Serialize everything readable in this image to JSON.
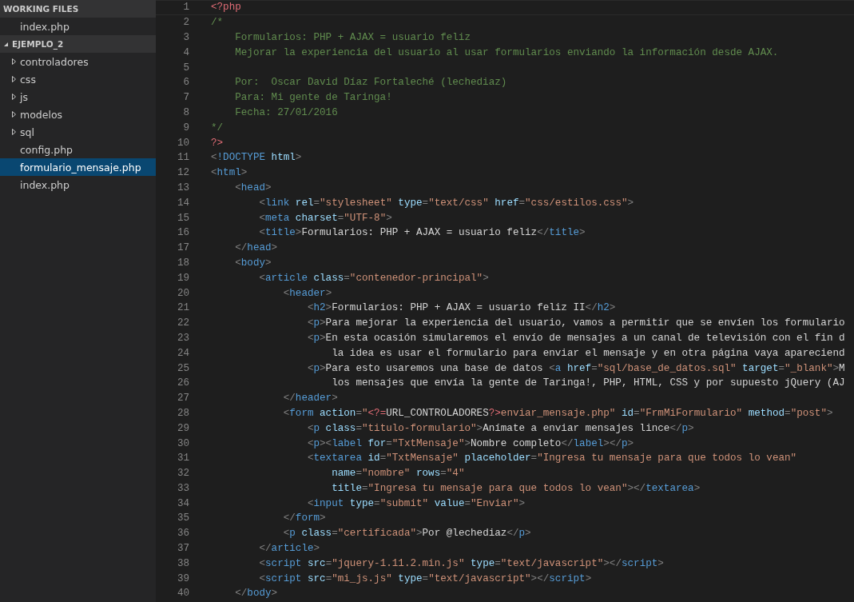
{
  "sidebar": {
    "sections": [
      {
        "title": "WORKING FILES",
        "items": [
          {
            "label": "index.php",
            "kind": "file",
            "selected": false
          }
        ]
      },
      {
        "title": "EJEMPLO_2",
        "expanded": true,
        "items": [
          {
            "label": "controladores",
            "kind": "folder",
            "expanded": false,
            "selected": false
          },
          {
            "label": "css",
            "kind": "folder",
            "expanded": false,
            "selected": false
          },
          {
            "label": "js",
            "kind": "folder",
            "expanded": false,
            "selected": false
          },
          {
            "label": "modelos",
            "kind": "folder",
            "expanded": false,
            "selected": false
          },
          {
            "label": "sql",
            "kind": "folder",
            "expanded": false,
            "selected": false
          },
          {
            "label": "config.php",
            "kind": "file",
            "selected": false
          },
          {
            "label": "formulario_mensaje.php",
            "kind": "file",
            "selected": true
          },
          {
            "label": "index.php",
            "kind": "file",
            "selected": false
          }
        ]
      }
    ]
  },
  "editor": {
    "lines": [
      {
        "number": "1",
        "current": true,
        "tokens": [
          {
            "kind": "php",
            "text": "<?php"
          }
        ]
      },
      {
        "number": "2",
        "current": false,
        "tokens": [
          {
            "kind": "comment",
            "text": "/*"
          }
        ]
      },
      {
        "number": "3",
        "current": false,
        "tokens": [
          {
            "kind": "comment",
            "text": "    Formularios: PHP + AJAX = usuario feliz"
          }
        ]
      },
      {
        "number": "4",
        "current": false,
        "tokens": [
          {
            "kind": "comment",
            "text": "    Mejorar la experiencia del usuario al usar formularios enviando la información desde AJAX."
          }
        ]
      },
      {
        "number": "5",
        "current": false
      },
      {
        "number": "6",
        "current": false,
        "tokens": [
          {
            "kind": "comment",
            "text": "    Por:  Oscar David Díaz Fortaleché (lechediaz)"
          }
        ]
      },
      {
        "number": "7",
        "current": false,
        "tokens": [
          {
            "kind": "comment",
            "text": "    Para: Mi gente de Taringa!"
          }
        ]
      },
      {
        "number": "8",
        "current": false,
        "tokens": [
          {
            "kind": "comment",
            "text": "    Fecha: 27/01/2016"
          }
        ]
      },
      {
        "number": "9",
        "current": false,
        "tokens": [
          {
            "kind": "comment",
            "text": "*/"
          }
        ]
      },
      {
        "number": "10",
        "current": false,
        "tokens": [
          {
            "kind": "php",
            "text": "?>"
          }
        ]
      },
      {
        "number": "11",
        "current": false,
        "tokens": [
          {
            "kind": "punct",
            "text": "<"
          },
          {
            "kind": "tag",
            "text": "!DOCTYPE"
          },
          {
            "kind": "attr",
            "text": " html"
          },
          {
            "kind": "punct",
            "text": ">"
          }
        ]
      },
      {
        "number": "12",
        "current": false,
        "tokens": [
          {
            "kind": "punct",
            "text": "<"
          },
          {
            "kind": "tag",
            "text": "html"
          },
          {
            "kind": "punct",
            "text": ">"
          }
        ]
      },
      {
        "number": "13",
        "current": false,
        "tokens": [
          {
            "kind": "punct",
            "text": "    <"
          },
          {
            "kind": "tag",
            "text": "head"
          },
          {
            "kind": "punct",
            "text": ">"
          }
        ]
      },
      {
        "number": "14",
        "current": false,
        "tokens": [
          {
            "kind": "punct",
            "text": "        <"
          },
          {
            "kind": "tag",
            "text": "link"
          },
          {
            "kind": "attr",
            "text": " rel"
          },
          {
            "kind": "punct",
            "text": "="
          },
          {
            "kind": "string",
            "text": "\"stylesheet\""
          },
          {
            "kind": "attr",
            "text": " type"
          },
          {
            "kind": "punct",
            "text": "="
          },
          {
            "kind": "string",
            "text": "\"text/css\""
          },
          {
            "kind": "attr",
            "text": " href"
          },
          {
            "kind": "punct",
            "text": "="
          },
          {
            "kind": "string",
            "text": "\"css/estilos.css\""
          },
          {
            "kind": "punct",
            "text": ">"
          }
        ]
      },
      {
        "number": "15",
        "current": false,
        "tokens": [
          {
            "kind": "punct",
            "text": "        <"
          },
          {
            "kind": "tag",
            "text": "meta"
          },
          {
            "kind": "attr",
            "text": " charset"
          },
          {
            "kind": "punct",
            "text": "="
          },
          {
            "kind": "string",
            "text": "\"UTF-8\""
          },
          {
            "kind": "punct",
            "text": ">"
          }
        ]
      },
      {
        "number": "16",
        "current": false,
        "tokens": [
          {
            "kind": "punct",
            "text": "        <"
          },
          {
            "kind": "tag",
            "text": "title"
          },
          {
            "kind": "punct",
            "text": ">"
          },
          {
            "kind": "text",
            "text": "Formularios: PHP + AJAX = usuario feliz"
          },
          {
            "kind": "punct",
            "text": "</"
          },
          {
            "kind": "tag",
            "text": "title"
          },
          {
            "kind": "punct",
            "text": ">"
          }
        ]
      },
      {
        "number": "17",
        "current": false,
        "tokens": [
          {
            "kind": "punct",
            "text": "    </"
          },
          {
            "kind": "tag",
            "text": "head"
          },
          {
            "kind": "punct",
            "text": ">"
          }
        ]
      },
      {
        "number": "18",
        "current": false,
        "tokens": [
          {
            "kind": "punct",
            "text": "    <"
          },
          {
            "kind": "tag",
            "text": "body"
          },
          {
            "kind": "punct",
            "text": ">"
          }
        ]
      },
      {
        "number": "19",
        "current": false,
        "tokens": [
          {
            "kind": "punct",
            "text": "        <"
          },
          {
            "kind": "tag",
            "text": "article"
          },
          {
            "kind": "attr",
            "text": " class"
          },
          {
            "kind": "punct",
            "text": "="
          },
          {
            "kind": "string",
            "text": "\"contenedor-principal\""
          },
          {
            "kind": "punct",
            "text": ">"
          }
        ]
      },
      {
        "number": "20",
        "current": false,
        "tokens": [
          {
            "kind": "punct",
            "text": "            <"
          },
          {
            "kind": "tag",
            "text": "header"
          },
          {
            "kind": "punct",
            "text": ">"
          }
        ]
      },
      {
        "number": "21",
        "current": false,
        "tokens": [
          {
            "kind": "punct",
            "text": "                <"
          },
          {
            "kind": "tag",
            "text": "h2"
          },
          {
            "kind": "punct",
            "text": ">"
          },
          {
            "kind": "text",
            "text": "Formularios: PHP + AJAX = usuario feliz II"
          },
          {
            "kind": "punct",
            "text": "</"
          },
          {
            "kind": "tag",
            "text": "h2"
          },
          {
            "kind": "punct",
            "text": ">"
          }
        ]
      },
      {
        "number": "22",
        "current": false,
        "tokens": [
          {
            "kind": "punct",
            "text": "                <"
          },
          {
            "kind": "tag",
            "text": "p"
          },
          {
            "kind": "punct",
            "text": ">"
          },
          {
            "kind": "text",
            "text": "Para mejorar la experiencia del usuario, vamos a permitir que se envíen los formulario"
          }
        ]
      },
      {
        "number": "23",
        "current": false,
        "tokens": [
          {
            "kind": "punct",
            "text": "                <"
          },
          {
            "kind": "tag",
            "text": "p"
          },
          {
            "kind": "punct",
            "text": ">"
          },
          {
            "kind": "text",
            "text": "En esta ocasión simularemos el envío de mensajes a un canal de televisión con el fin d"
          }
        ]
      },
      {
        "number": "24",
        "current": false,
        "tokens": [
          {
            "kind": "text",
            "text": "                    la idea es usar el formulario para enviar el mensaje y en otra página vaya apareciend"
          }
        ]
      },
      {
        "number": "25",
        "current": false,
        "tokens": [
          {
            "kind": "punct",
            "text": "                <"
          },
          {
            "kind": "tag",
            "text": "p"
          },
          {
            "kind": "punct",
            "text": ">"
          },
          {
            "kind": "text",
            "text": "Para esto usaremos una base de datos "
          },
          {
            "kind": "punct",
            "text": "<"
          },
          {
            "kind": "tag",
            "text": "a"
          },
          {
            "kind": "attr",
            "text": " href"
          },
          {
            "kind": "punct",
            "text": "="
          },
          {
            "kind": "string",
            "text": "\"sql/base_de_datos.sql\""
          },
          {
            "kind": "attr",
            "text": " target"
          },
          {
            "kind": "punct",
            "text": "="
          },
          {
            "kind": "string",
            "text": "\"_blank\""
          },
          {
            "kind": "punct",
            "text": ">"
          },
          {
            "kind": "text",
            "text": "M"
          }
        ]
      },
      {
        "number": "26",
        "current": false,
        "tokens": [
          {
            "kind": "text",
            "text": "                    los mensajes que envía la gente de Taringa!, PHP, HTML, CSS y por supuesto jQuery (AJ"
          }
        ]
      },
      {
        "number": "27",
        "current": false,
        "tokens": [
          {
            "kind": "punct",
            "text": "            </"
          },
          {
            "kind": "tag",
            "text": "header"
          },
          {
            "kind": "punct",
            "text": ">"
          }
        ]
      },
      {
        "number": "28",
        "current": false,
        "tokens": [
          {
            "kind": "punct",
            "text": "            <"
          },
          {
            "kind": "tag",
            "text": "form"
          },
          {
            "kind": "attr",
            "text": " action"
          },
          {
            "kind": "punct",
            "text": "="
          },
          {
            "kind": "string",
            "text": "\""
          },
          {
            "kind": "php",
            "text": "<?="
          },
          {
            "kind": "text",
            "text": "URL_CONTROLADORES"
          },
          {
            "kind": "php",
            "text": "?>"
          },
          {
            "kind": "string",
            "text": "enviar_mensaje.php\""
          },
          {
            "kind": "attr",
            "text": " id"
          },
          {
            "kind": "punct",
            "text": "="
          },
          {
            "kind": "string",
            "text": "\"FrmMiFormulario\""
          },
          {
            "kind": "attr",
            "text": " method"
          },
          {
            "kind": "punct",
            "text": "="
          },
          {
            "kind": "string",
            "text": "\"post\""
          },
          {
            "kind": "punct",
            "text": ">"
          }
        ]
      },
      {
        "number": "29",
        "current": false,
        "tokens": [
          {
            "kind": "punct",
            "text": "                <"
          },
          {
            "kind": "tag",
            "text": "p"
          },
          {
            "kind": "attr",
            "text": " class"
          },
          {
            "kind": "punct",
            "text": "="
          },
          {
            "kind": "string",
            "text": "\"titulo-formulario\""
          },
          {
            "kind": "punct",
            "text": ">"
          },
          {
            "kind": "text",
            "text": "Anímate a enviar mensajes lince"
          },
          {
            "kind": "punct",
            "text": "</"
          },
          {
            "kind": "tag",
            "text": "p"
          },
          {
            "kind": "punct",
            "text": ">"
          }
        ]
      },
      {
        "number": "30",
        "current": false,
        "tokens": [
          {
            "kind": "punct",
            "text": "                <"
          },
          {
            "kind": "tag",
            "text": "p"
          },
          {
            "kind": "punct",
            "text": "><"
          },
          {
            "kind": "tag",
            "text": "label"
          },
          {
            "kind": "attr",
            "text": " for"
          },
          {
            "kind": "punct",
            "text": "="
          },
          {
            "kind": "string",
            "text": "\"TxtMensaje\""
          },
          {
            "kind": "punct",
            "text": ">"
          },
          {
            "kind": "text",
            "text": "Nombre completo"
          },
          {
            "kind": "punct",
            "text": "</"
          },
          {
            "kind": "tag",
            "text": "label"
          },
          {
            "kind": "punct",
            "text": "></"
          },
          {
            "kind": "tag",
            "text": "p"
          },
          {
            "kind": "punct",
            "text": ">"
          }
        ]
      },
      {
        "number": "31",
        "current": false,
        "tokens": [
          {
            "kind": "punct",
            "text": "                <"
          },
          {
            "kind": "tag",
            "text": "textarea"
          },
          {
            "kind": "attr",
            "text": " id"
          },
          {
            "kind": "punct",
            "text": "="
          },
          {
            "kind": "string",
            "text": "\"TxtMensaje\""
          },
          {
            "kind": "attr",
            "text": " placeholder"
          },
          {
            "kind": "punct",
            "text": "="
          },
          {
            "kind": "string",
            "text": "\"Ingresa tu mensaje para que todos lo vean\""
          }
        ]
      },
      {
        "number": "32",
        "current": false,
        "tokens": [
          {
            "kind": "attr",
            "text": "                    name"
          },
          {
            "kind": "punct",
            "text": "="
          },
          {
            "kind": "string",
            "text": "\"nombre\""
          },
          {
            "kind": "attr",
            "text": " rows"
          },
          {
            "kind": "punct",
            "text": "="
          },
          {
            "kind": "string",
            "text": "\"4\""
          }
        ]
      },
      {
        "number": "33",
        "current": false,
        "tokens": [
          {
            "kind": "attr",
            "text": "                    title"
          },
          {
            "kind": "punct",
            "text": "="
          },
          {
            "kind": "string",
            "text": "\"Ingresa tu mensaje para que todos lo vean\""
          },
          {
            "kind": "punct",
            "text": "></"
          },
          {
            "kind": "tag",
            "text": "textarea"
          },
          {
            "kind": "punct",
            "text": ">"
          }
        ]
      },
      {
        "number": "34",
        "current": false,
        "tokens": [
          {
            "kind": "punct",
            "text": "                <"
          },
          {
            "kind": "tag",
            "text": "input"
          },
          {
            "kind": "attr",
            "text": " type"
          },
          {
            "kind": "punct",
            "text": "="
          },
          {
            "kind": "string",
            "text": "\"submit\""
          },
          {
            "kind": "attr",
            "text": " value"
          },
          {
            "kind": "punct",
            "text": "="
          },
          {
            "kind": "string",
            "text": "\"Enviar\""
          },
          {
            "kind": "punct",
            "text": ">"
          }
        ]
      },
      {
        "number": "35",
        "current": false,
        "tokens": [
          {
            "kind": "punct",
            "text": "            </"
          },
          {
            "kind": "tag",
            "text": "form"
          },
          {
            "kind": "punct",
            "text": ">"
          }
        ]
      },
      {
        "number": "36",
        "current": false,
        "tokens": [
          {
            "kind": "punct",
            "text": "            <"
          },
          {
            "kind": "tag",
            "text": "p"
          },
          {
            "kind": "attr",
            "text": " class"
          },
          {
            "kind": "punct",
            "text": "="
          },
          {
            "kind": "string",
            "text": "\"certificada\""
          },
          {
            "kind": "punct",
            "text": ">"
          },
          {
            "kind": "text",
            "text": "Por @lechediaz"
          },
          {
            "kind": "punct",
            "text": "</"
          },
          {
            "kind": "tag",
            "text": "p"
          },
          {
            "kind": "punct",
            "text": ">"
          }
        ]
      },
      {
        "number": "37",
        "current": false,
        "tokens": [
          {
            "kind": "punct",
            "text": "        </"
          },
          {
            "kind": "tag",
            "text": "article"
          },
          {
            "kind": "punct",
            "text": ">"
          }
        ]
      },
      {
        "number": "38",
        "current": false,
        "tokens": [
          {
            "kind": "punct",
            "text": "        <"
          },
          {
            "kind": "tag",
            "text": "script"
          },
          {
            "kind": "attr",
            "text": " src"
          },
          {
            "kind": "punct",
            "text": "="
          },
          {
            "kind": "string",
            "text": "\"jquery-1.11.2.min.js\""
          },
          {
            "kind": "attr",
            "text": " type"
          },
          {
            "kind": "punct",
            "text": "="
          },
          {
            "kind": "string",
            "text": "\"text/javascript\""
          },
          {
            "kind": "punct",
            "text": "></"
          },
          {
            "kind": "tag",
            "text": "script"
          },
          {
            "kind": "punct",
            "text": ">"
          }
        ]
      },
      {
        "number": "39",
        "current": false,
        "tokens": [
          {
            "kind": "punct",
            "text": "        <"
          },
          {
            "kind": "tag",
            "text": "script"
          },
          {
            "kind": "attr",
            "text": " src"
          },
          {
            "kind": "punct",
            "text": "="
          },
          {
            "kind": "string",
            "text": "\"mi_js.js\""
          },
          {
            "kind": "attr",
            "text": " type"
          },
          {
            "kind": "punct",
            "text": "="
          },
          {
            "kind": "string",
            "text": "\"text/javascript\""
          },
          {
            "kind": "punct",
            "text": "></"
          },
          {
            "kind": "tag",
            "text": "script"
          },
          {
            "kind": "punct",
            "text": ">"
          }
        ]
      },
      {
        "number": "40",
        "current": false,
        "tokens": [
          {
            "kind": "punct",
            "text": "    </"
          },
          {
            "kind": "tag",
            "text": "body"
          },
          {
            "kind": "punct",
            "text": ">"
          }
        ]
      }
    ]
  }
}
